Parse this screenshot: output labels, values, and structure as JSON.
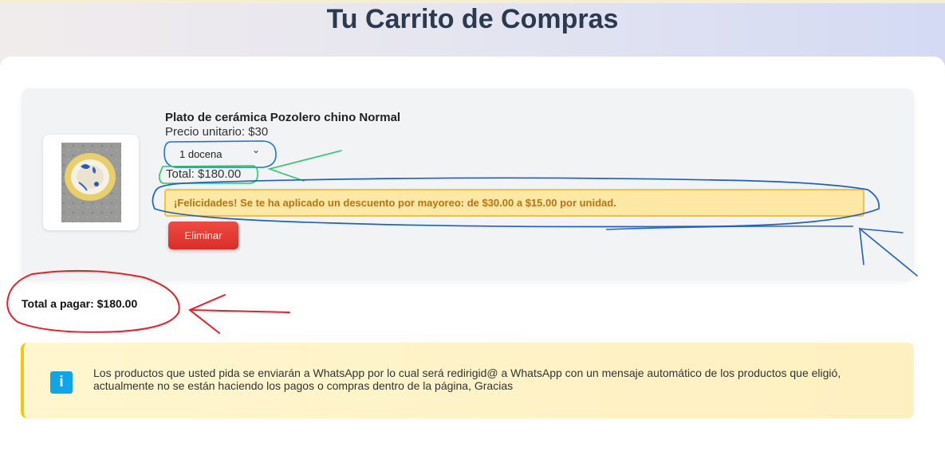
{
  "page": {
    "title": "Tu Carrito de Compras"
  },
  "cart": {
    "items": [
      {
        "name": "Plato de cerámica Pozolero chino Normal",
        "unit_price": "Precio unitario: $30",
        "quantity_selected": "1 docena",
        "total": "Total: $180.00",
        "discount_message": "¡Felicidades! Se te ha aplicado un descuento por mayoreo: de $30.00 a $15.00 por unidad.",
        "remove_label": "Eliminar"
      }
    ],
    "grand_total": "Total a pagar: $180.00"
  },
  "info": {
    "icon": "info-icon",
    "glyph": "i",
    "message": "Los productos que usted pida se enviarán a WhatsApp por lo cual será redirigid@ a WhatsApp con un mensaje automático de los productos que eligió, actualmente no se están haciendo los pagos o compras dentro de la página, Gracias"
  },
  "colors": {
    "title": "#2b3a4e",
    "discount_text": "#b87310",
    "discount_bg": "#fde8a6",
    "remove_button": "#e53935",
    "info_icon": "#0ea5e9",
    "annotation_red": "#e8202a",
    "annotation_blue": "#1f5fc6",
    "annotation_green": "#2ec46d"
  }
}
